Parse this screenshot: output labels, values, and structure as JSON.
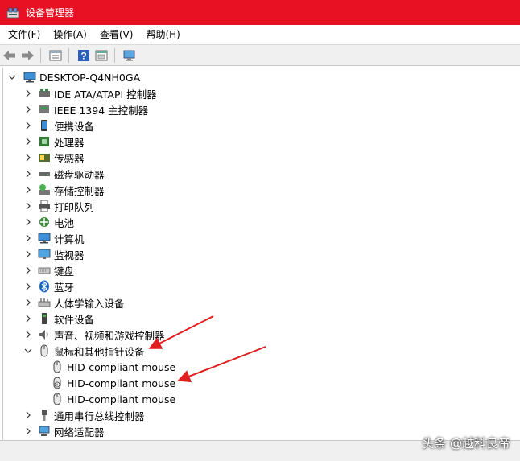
{
  "window": {
    "title": "设备管理器"
  },
  "menu": [
    "文件(F)",
    "操作(A)",
    "查看(V)",
    "帮助(H)"
  ],
  "toolbar": {
    "buttons": [
      "back-icon",
      "forward-icon",
      "properties-icon",
      "help-icon",
      "update-driver-icon",
      "scan-hardware-icon"
    ]
  },
  "tree": {
    "root": "DESKTOP-Q4NH0GA",
    "categories": [
      {
        "label": "IDE ATA/ATAPI 控制器",
        "icon": "ide-controller-icon",
        "expanded": false
      },
      {
        "label": "IEEE 1394 主控制器",
        "icon": "ieee1394-icon",
        "expanded": false
      },
      {
        "label": "便携设备",
        "icon": "portable-device-icon",
        "expanded": false
      },
      {
        "label": "处理器",
        "icon": "processor-icon",
        "expanded": false
      },
      {
        "label": "传感器",
        "icon": "sensor-icon",
        "expanded": false
      },
      {
        "label": "磁盘驱动器",
        "icon": "disk-drive-icon",
        "expanded": false
      },
      {
        "label": "存储控制器",
        "icon": "storage-controller-icon",
        "expanded": false
      },
      {
        "label": "打印队列",
        "icon": "printer-icon",
        "expanded": false
      },
      {
        "label": "电池",
        "icon": "battery-icon",
        "expanded": false
      },
      {
        "label": "计算机",
        "icon": "computer-icon",
        "expanded": false
      },
      {
        "label": "监视器",
        "icon": "monitor-icon",
        "expanded": false
      },
      {
        "label": "键盘",
        "icon": "keyboard-icon",
        "expanded": false
      },
      {
        "label": "蓝牙",
        "icon": "bluetooth-icon",
        "expanded": false
      },
      {
        "label": "人体学输入设备",
        "icon": "hid-icon",
        "expanded": false
      },
      {
        "label": "软件设备",
        "icon": "software-device-icon",
        "expanded": false
      },
      {
        "label": "声音、视频和游戏控制器",
        "icon": "sound-icon",
        "expanded": false
      },
      {
        "label": "鼠标和其他指针设备",
        "icon": "mouse-icon",
        "expanded": true,
        "children": [
          {
            "label": "HID-compliant mouse",
            "icon": "mouse-icon"
          },
          {
            "label": "HID-compliant mouse",
            "icon": "mouse-warning-icon"
          },
          {
            "label": "HID-compliant mouse",
            "icon": "mouse-icon"
          }
        ]
      },
      {
        "label": "通用串行总线控制器",
        "icon": "usb-icon",
        "expanded": false
      },
      {
        "label": "网络适配器",
        "icon": "network-adapter-icon",
        "expanded": false
      }
    ]
  },
  "watermark": "头条 @越科良帝",
  "colors": {
    "title_bar": "#e81123",
    "annotation_arrow": "#e02020"
  }
}
